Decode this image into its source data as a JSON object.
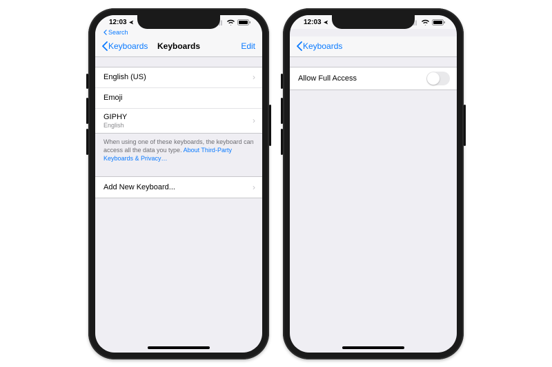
{
  "status": {
    "time": "12:03",
    "location_glyph": "➤"
  },
  "breadcrumb": {
    "label": "Search"
  },
  "left": {
    "back_label": "Keyboards",
    "title": "Keyboards",
    "edit_label": "Edit",
    "rows": [
      {
        "label": "English (US)",
        "sub": "",
        "chevron": true
      },
      {
        "label": "Emoji",
        "sub": "",
        "chevron": false
      },
      {
        "label": "GIPHY",
        "sub": "English",
        "chevron": true
      }
    ],
    "footer": {
      "text": "When using one of these keyboards, the keyboard can access all the data you type. ",
      "link": "About Third-Party Keyboards & Privacy…"
    },
    "add_label": "Add New Keyboard..."
  },
  "right": {
    "back_label": "Keyboards",
    "toggle_label": "Allow Full Access",
    "toggle_on": false
  }
}
